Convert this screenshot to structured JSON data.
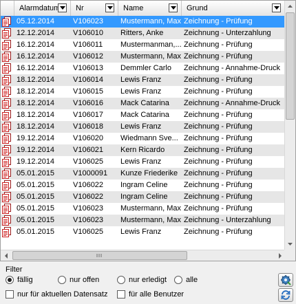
{
  "columns": {
    "alarmdatum": "Alarmdatum",
    "nr": "Nr",
    "name": "Name",
    "grund": "Grund"
  },
  "rows": [
    {
      "datum": "05.12.2014",
      "nr": "V106023",
      "name": "Mustermann, Max",
      "grund": "Zeichnung - Prüfung"
    },
    {
      "datum": "12.12.2014",
      "nr": "V106010",
      "name": "Ritters, Anke",
      "grund": "Zeichnung - Unterzahlung"
    },
    {
      "datum": "16.12.2014",
      "nr": "V106011",
      "name": "Mustermanman,...",
      "grund": "Zeichnung - Prüfung"
    },
    {
      "datum": "16.12.2014",
      "nr": "V106012",
      "name": "Mustermann, Max",
      "grund": "Zeichnung - Prüfung"
    },
    {
      "datum": "16.12.2014",
      "nr": "V106013",
      "name": "Demmler Carlo",
      "grund": "Zeichnung - Annahme-Druck"
    },
    {
      "datum": "18.12.2014",
      "nr": "V106014",
      "name": "Lewis Franz",
      "grund": "Zeichnung - Prüfung"
    },
    {
      "datum": "18.12.2014",
      "nr": "V106015",
      "name": "Lewis Franz",
      "grund": "Zeichnung - Prüfung"
    },
    {
      "datum": "18.12.2014",
      "nr": "V106016",
      "name": "Mack Catarina",
      "grund": "Zeichnung - Annahme-Druck"
    },
    {
      "datum": "18.12.2014",
      "nr": "V106017",
      "name": "Mack Catarina",
      "grund": "Zeichnung - Prüfung"
    },
    {
      "datum": "18.12.2014",
      "nr": "V106018",
      "name": "Lewis Franz",
      "grund": "Zeichnung - Prüfung"
    },
    {
      "datum": "19.12.2014",
      "nr": "V106020",
      "name": "Wiedmann Sve...",
      "grund": "Zeichnung - Prüfung"
    },
    {
      "datum": "19.12.2014",
      "nr": "V106021",
      "name": "Kern Ricardo",
      "grund": "Zeichnung - Prüfung"
    },
    {
      "datum": "19.12.2014",
      "nr": "V106025",
      "name": "Lewis Franz",
      "grund": "Zeichnung - Prüfung"
    },
    {
      "datum": "05.01.2015",
      "nr": "V1000091",
      "name": "Kunze Friederike",
      "grund": "Zeichnung - Prüfung"
    },
    {
      "datum": "05.01.2015",
      "nr": "V106022",
      "name": "Ingram Celine",
      "grund": "Zeichnung - Prüfung"
    },
    {
      "datum": "05.01.2015",
      "nr": "V106022",
      "name": "Ingram Celine",
      "grund": "Zeichnung - Prüfung"
    },
    {
      "datum": "05.01.2015",
      "nr": "V106023",
      "name": "Mustermann, Max",
      "grund": "Zeichnung - Prüfung"
    },
    {
      "datum": "05.01.2015",
      "nr": "V106023",
      "name": "Mustermann, Max",
      "grund": "Zeichnung - Unterzahlung"
    },
    {
      "datum": "05.01.2015",
      "nr": "V106025",
      "name": "Lewis Franz",
      "grund": "Zeichnung - Prüfung"
    }
  ],
  "selected_row": 0,
  "filter": {
    "label": "Filter",
    "radios": [
      "fällig",
      "nur offen",
      "nur erledigt",
      "alle"
    ],
    "checked_radio": 0,
    "checkboxes": [
      "nur für aktuellen Datensatz",
      "für alle Benutzer"
    ]
  },
  "colors": {
    "selection": "#3399ff",
    "row_alt": "#e6e6e6",
    "doc_icon": "#cc1f1f"
  },
  "icons": {
    "row_icon": "document-alarm-icon",
    "settings_button": "gear-settings-icon",
    "refresh_button": "refresh-icon"
  }
}
